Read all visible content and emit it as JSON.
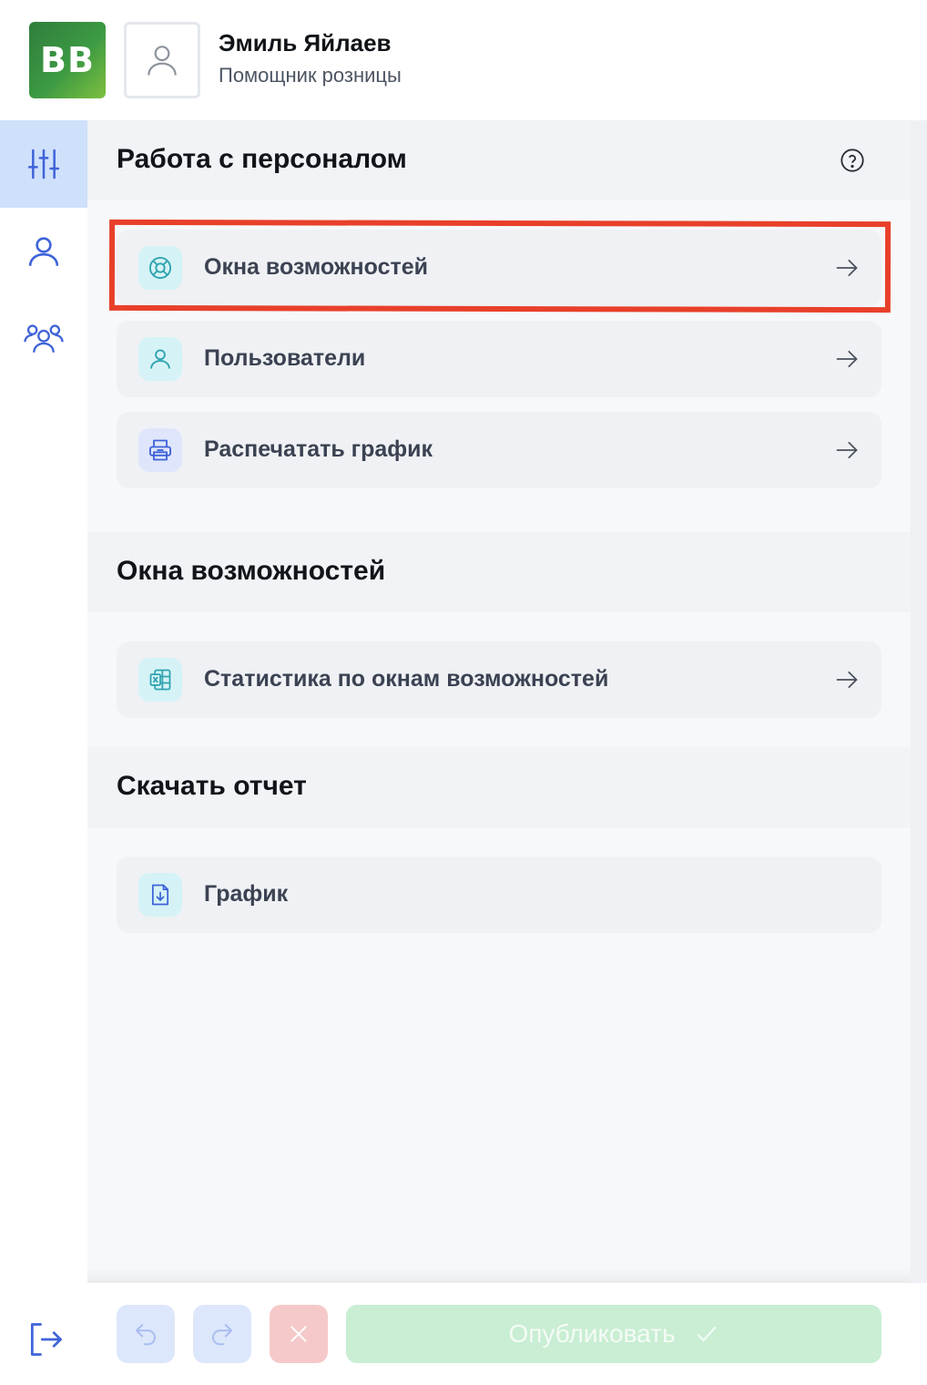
{
  "header": {
    "logo_text": "BB",
    "user_name": "Эмиль Яйлаев",
    "user_role": "Помощник розницы"
  },
  "rail": {
    "items": [
      {
        "icon": "sliders-icon",
        "active": true
      },
      {
        "icon": "user-icon",
        "active": false
      },
      {
        "icon": "users-icon",
        "active": false
      }
    ],
    "logout_icon": "logout-icon"
  },
  "sections": [
    {
      "title": "Работа с персоналом",
      "has_help": true,
      "items": [
        {
          "label": "Окна возможностей",
          "icon": "lifebuoy-icon",
          "highlighted": true
        },
        {
          "label": "Пользователи",
          "icon": "user-icon"
        },
        {
          "label": "Распечатать график",
          "icon": "printer-icon"
        }
      ]
    },
    {
      "title": "Окна возможностей",
      "items": [
        {
          "label": "Статистика по окнам возможностей",
          "icon": "excel-icon"
        }
      ]
    },
    {
      "title": "Скачать отчет",
      "items": [
        {
          "label": "График",
          "icon": "file-download-icon"
        }
      ]
    }
  ],
  "footer": {
    "publish_label": "Опубликовать"
  },
  "colors": {
    "accent_blue": "#3f63d9",
    "teal": "#2fa3b0",
    "highlight_red": "#e8402a",
    "publish_green": "#c9eed3"
  }
}
